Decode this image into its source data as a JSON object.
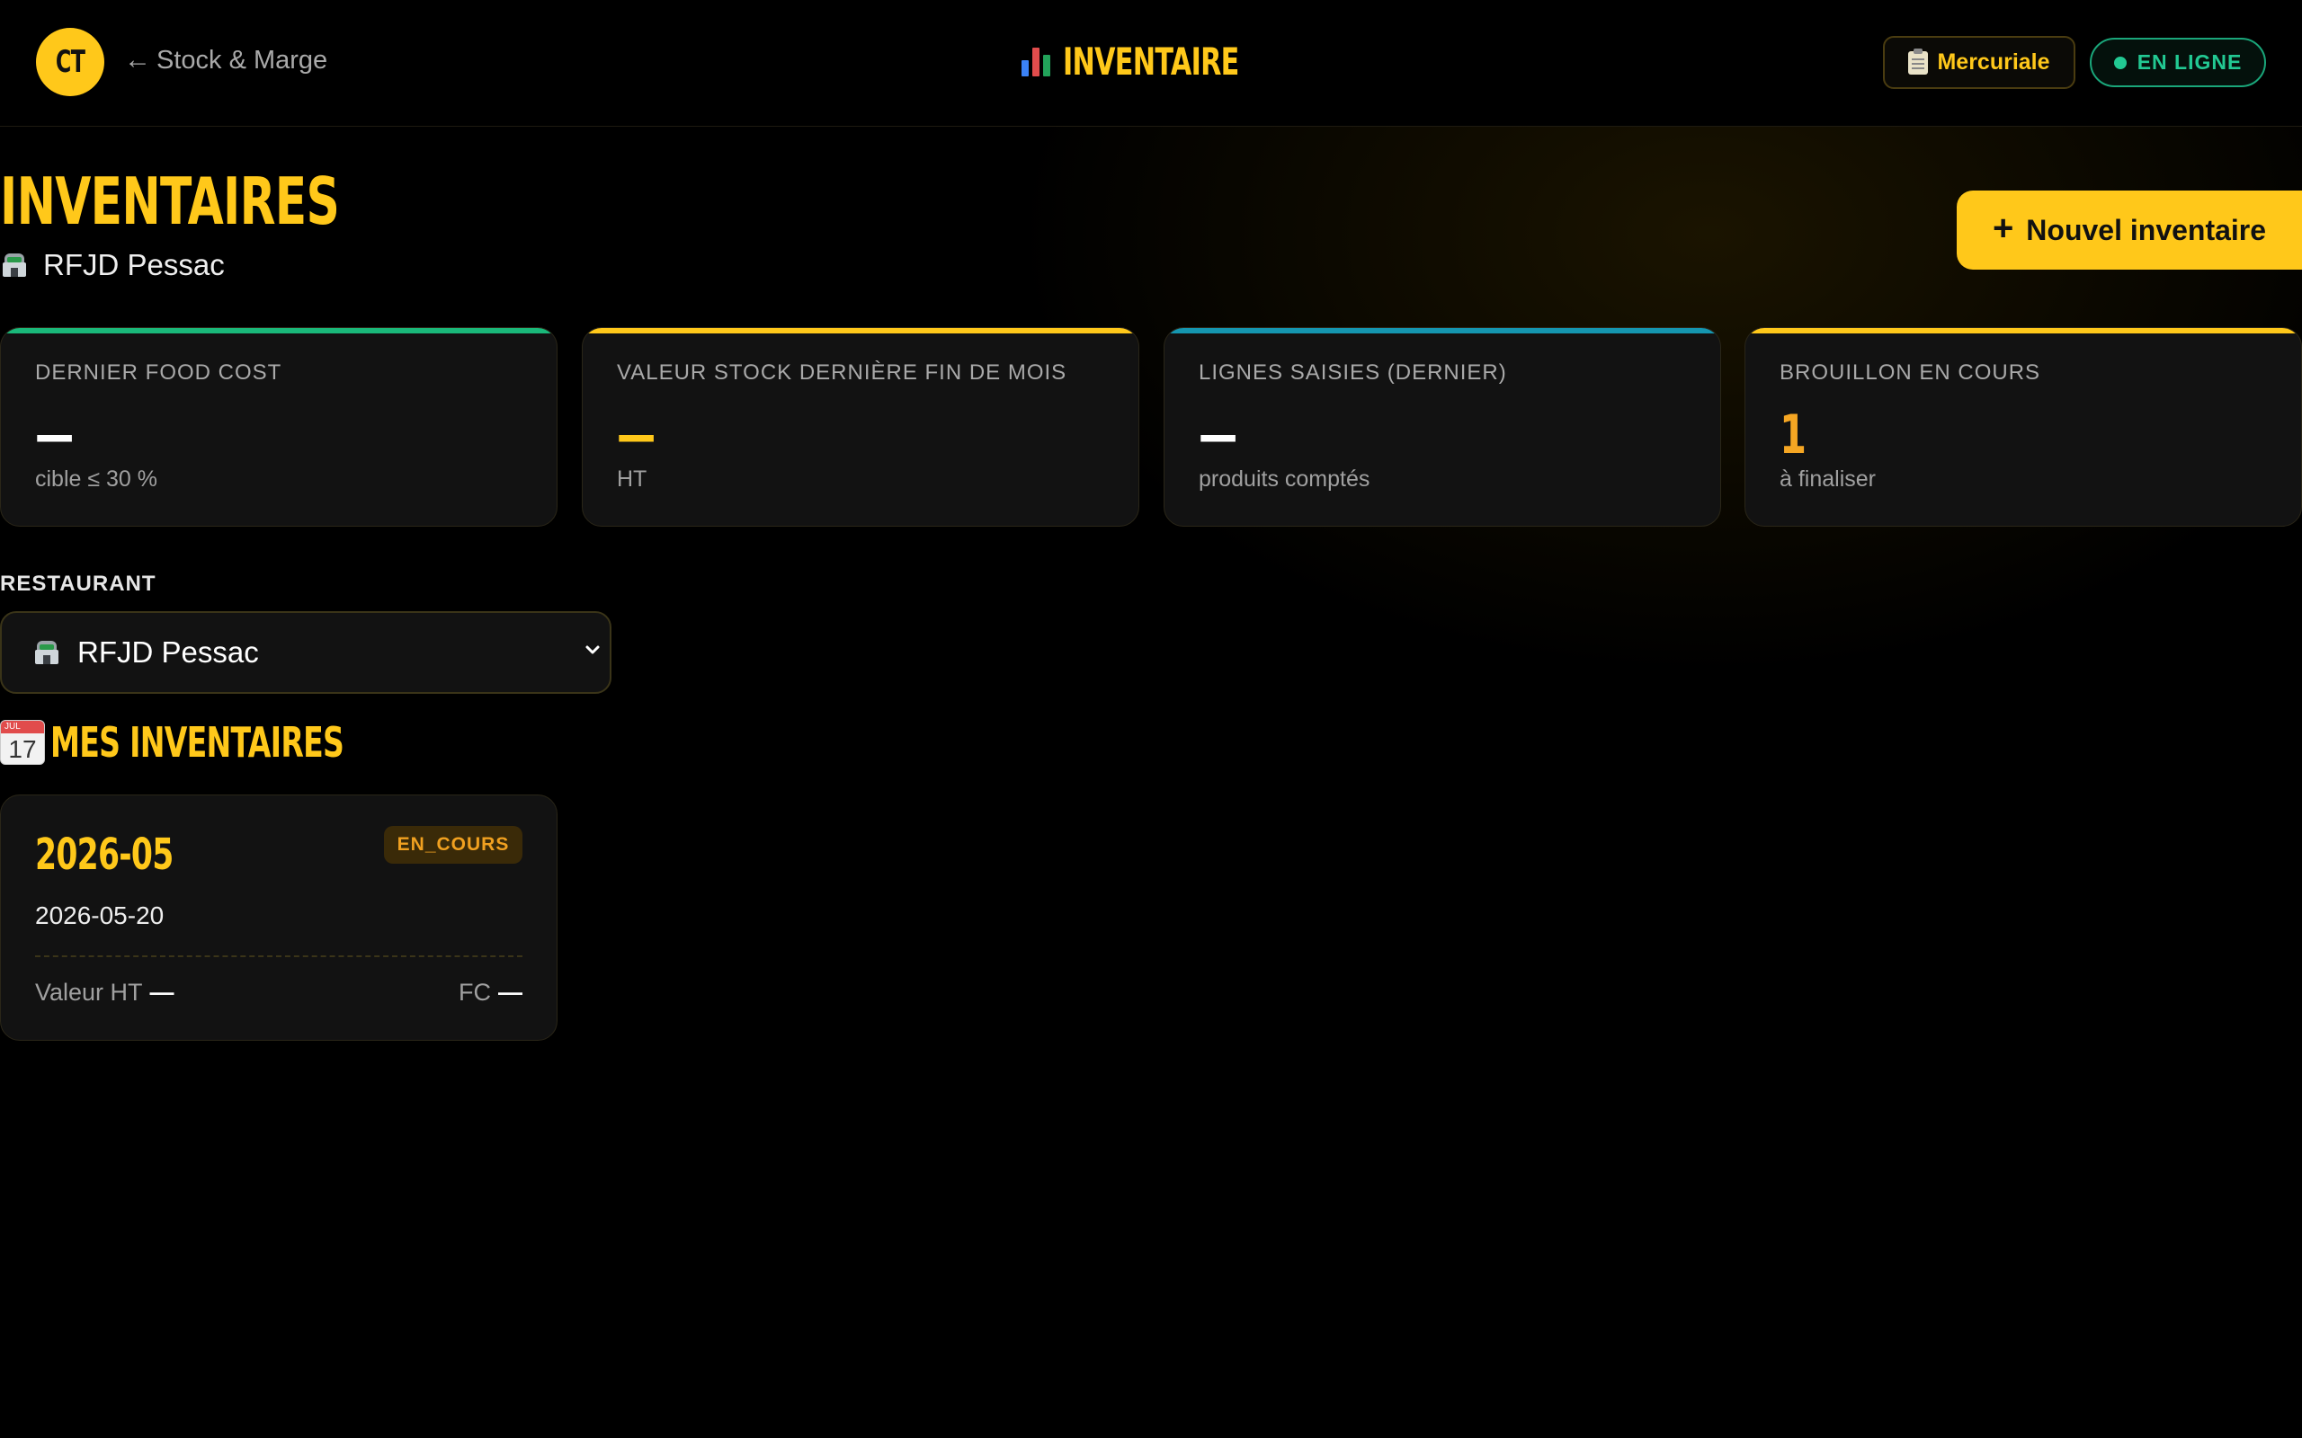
{
  "header": {
    "logo_text": "CT",
    "back_arrow": "←",
    "back_label": "Stock & Marge",
    "title": "INVENTAIRE",
    "mercuriale_label": "Mercuriale",
    "status_label": "EN LIGNE"
  },
  "page": {
    "title": "INVENTAIRES",
    "subtitle": "RFJD Pessac",
    "new_button_plus": "+",
    "new_button_label": "Nouvel inventaire"
  },
  "stats": [
    {
      "label": "DERNIER FOOD COST",
      "value": "—",
      "note": "cible ≤ 30 %",
      "accent": "#1ab87a",
      "value_color": "#ffffff"
    },
    {
      "label": "VALEUR STOCK DERNIÈRE FIN DE MOIS",
      "value": "—",
      "note": "HT",
      "accent": "#ffc81a",
      "value_color": "#ffc81a"
    },
    {
      "label": "LIGNES SAISIES (DERNIER)",
      "value": "—",
      "note": "produits comptés",
      "accent": "#1596b0",
      "value_color": "#ffffff"
    },
    {
      "label": "BROUILLON EN COURS",
      "value": "1",
      "note": "à finaliser",
      "accent": "#ffc81a",
      "value_color": "#f5a623"
    }
  ],
  "restaurant_field": {
    "label": "RESTAURANT",
    "selected": "RFJD Pessac"
  },
  "section": {
    "calendar_month": "JUL",
    "calendar_day": "17",
    "title": "MES INVENTAIRES"
  },
  "inventories": [
    {
      "period": "2026-05",
      "status": "EN_COURS",
      "date": "2026-05-20",
      "value_label": "Valeur HT",
      "value": "—",
      "fc_label": "FC",
      "fc_value": "—"
    }
  ],
  "colors": {
    "accent": "#ffc81a",
    "online": "#22c993",
    "background": "#000000",
    "card": "#121212"
  }
}
